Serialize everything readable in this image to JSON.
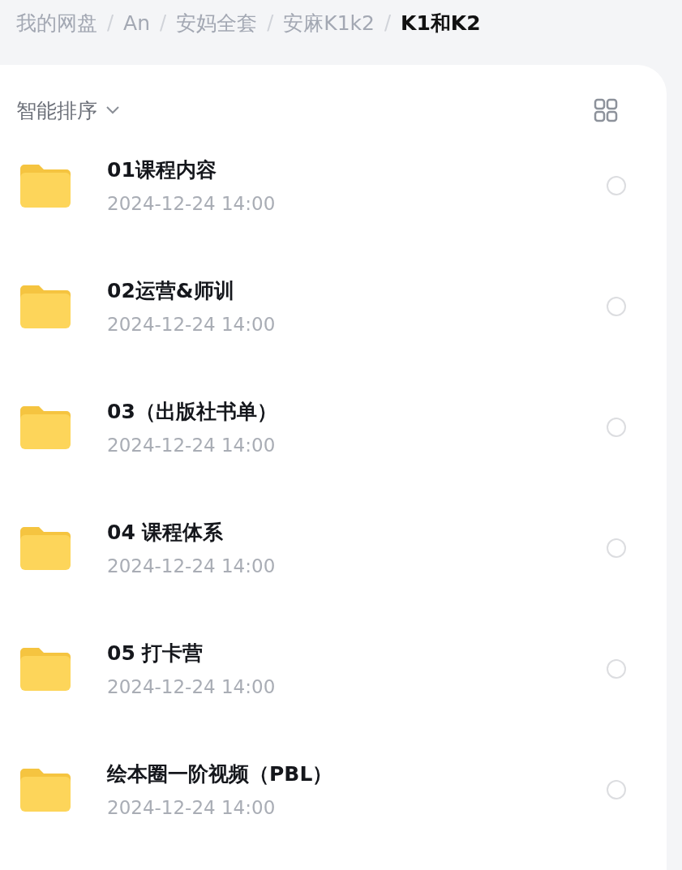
{
  "breadcrumb": [
    {
      "kind": "crumb",
      "label": "我的网盘",
      "current": false
    },
    {
      "kind": "separator",
      "label": "/"
    },
    {
      "kind": "crumb",
      "label": "An",
      "current": false
    },
    {
      "kind": "separator",
      "label": "/"
    },
    {
      "kind": "crumb",
      "label": "安妈全套",
      "current": false
    },
    {
      "kind": "separator",
      "label": "/"
    },
    {
      "kind": "crumb",
      "label": "安麻K1k2",
      "current": false
    },
    {
      "kind": "separator",
      "label": "/"
    },
    {
      "kind": "crumb",
      "label": "K1和K2",
      "current": true
    }
  ],
  "sort": {
    "label": "智能排序"
  },
  "files": [
    {
      "name": "01课程内容",
      "date": "2024-12-24 14:00",
      "selected": false
    },
    {
      "name": "02运营&师训",
      "date": "2024-12-24 14:00",
      "selected": false
    },
    {
      "name": "03（出版社书单）",
      "date": "2024-12-24 14:00",
      "selected": false
    },
    {
      "name": "04 课程体系",
      "date": "2024-12-24 14:00",
      "selected": false
    },
    {
      "name": "05 打卡营",
      "date": "2024-12-24 14:00",
      "selected": false
    },
    {
      "name": "绘本圈一阶视频（PBL）",
      "date": "2024-12-24 14:00",
      "selected": false
    }
  ]
}
